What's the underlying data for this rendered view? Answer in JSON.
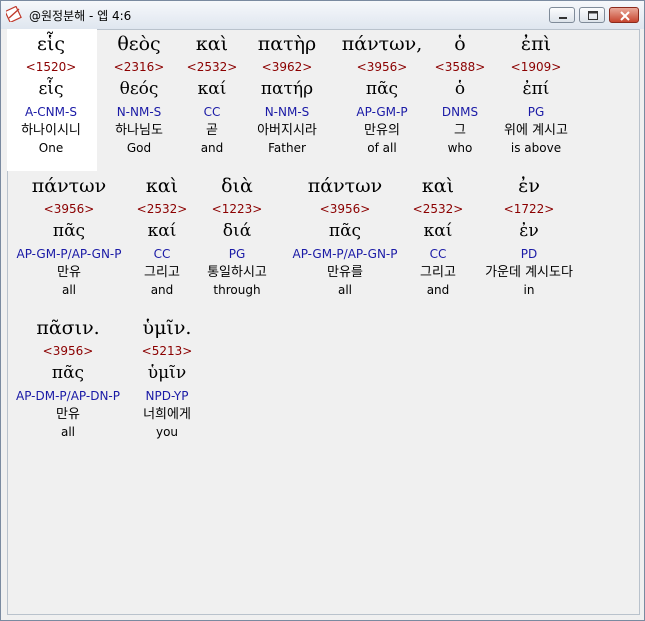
{
  "window": {
    "title": "@원정분해 - 엡 4:6"
  },
  "verse_words": [
    {
      "greek": "εἷς",
      "strongs": "<1520>",
      "lemma": "εἷς",
      "parse": "A-CNM-S",
      "korean": "하나이시니",
      "english": "One"
    },
    {
      "greek": "θεὸς",
      "strongs": "<2316>",
      "lemma": "θεός",
      "parse": "N-NM-S",
      "korean": "하나님도",
      "english": "God"
    },
    {
      "greek": "καὶ",
      "strongs": "<2532>",
      "lemma": "καί",
      "parse": "CC",
      "korean": "곧",
      "english": "and"
    },
    {
      "greek": "πατὴρ",
      "strongs": "<3962>",
      "lemma": "πατήρ",
      "parse": "N-NM-S",
      "korean": "아버지시라",
      "english": "Father"
    },
    {
      "greek": "πάντων,",
      "strongs": "<3956>",
      "lemma": "πᾶς",
      "parse": "AP-GM-P",
      "korean": "만유의",
      "english": "of all"
    },
    {
      "greek": "ὁ",
      "strongs": "<3588>",
      "lemma": "ὁ",
      "parse": "DNMS",
      "korean": "그",
      "english": "who"
    },
    {
      "greek": "ἐπὶ",
      "strongs": "<1909>",
      "lemma": "ἐπί",
      "parse": "PG",
      "korean": "위에 계시고",
      "english": "is above"
    },
    {
      "greek": "πάντων",
      "strongs": "<3956>",
      "lemma": "πᾶς",
      "parse": "AP-GM-P/AP-GN-P",
      "korean": "만유",
      "english": "all"
    },
    {
      "greek": "καὶ",
      "strongs": "<2532>",
      "lemma": "καί",
      "parse": "CC",
      "korean": "그리고",
      "english": "and"
    },
    {
      "greek": "διὰ",
      "strongs": "<1223>",
      "lemma": "διά",
      "parse": "PG",
      "korean": "통일하시고",
      "english": "through"
    },
    {
      "greek": "πάντων",
      "strongs": "<3956>",
      "lemma": "πᾶς",
      "parse": "AP-GM-P/AP-GN-P",
      "korean": "만유를",
      "english": "all"
    },
    {
      "greek": "καὶ",
      "strongs": "<2532>",
      "lemma": "καί",
      "parse": "CC",
      "korean": "그리고",
      "english": "and"
    },
    {
      "greek": "ἐν",
      "strongs": "<1722>",
      "lemma": "ἐν",
      "parse": "PD",
      "korean": "가운데 계시도다",
      "english": "in"
    },
    {
      "greek": "πᾶσιν.",
      "strongs": "<3956>",
      "lemma": "πᾶς",
      "parse": "AP-DM-P/AP-DN-P",
      "korean": "만유",
      "english": "all"
    },
    {
      "greek": "ὑμῖν.",
      "strongs": "<5213>",
      "lemma": "ὑμῖν",
      "parse": "NPD-YP",
      "korean": "너희에게",
      "english": "you"
    }
  ],
  "colors": {
    "strongs": "#8b0000",
    "parse": "#1a1aa6",
    "selection_bg": "#ffffff"
  }
}
